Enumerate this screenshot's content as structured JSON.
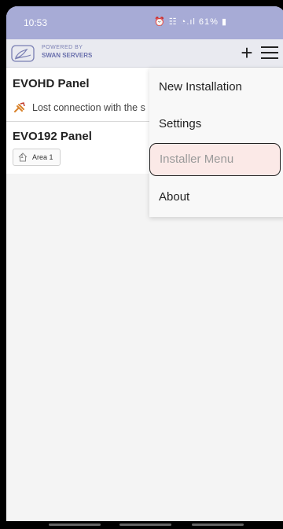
{
  "status_bar": {
    "time": "10:53",
    "icons": "⏰ ☷ ◔.ıl 61% ▮"
  },
  "app_bar": {
    "logo_top": "POWERED BY",
    "logo_bottom": "SWAN SERVERS",
    "add_glyph": "+"
  },
  "panels": [
    {
      "name": "EVOHD Panel",
      "status": "Lost connection with the s"
    },
    {
      "name": "EVO192 Panel",
      "area_label": "Area 1",
      "area_number": "1"
    }
  ],
  "menu": {
    "items": [
      {
        "label": "New Installation"
      },
      {
        "label": "Settings"
      },
      {
        "label": "Installer Menu",
        "selected": true
      },
      {
        "label": "About"
      }
    ]
  },
  "colors": {
    "status_bar": "#a7abd6",
    "accent": "#6b71ad",
    "warning": "#d9822b",
    "selected_bg": "#fbe9e7"
  }
}
